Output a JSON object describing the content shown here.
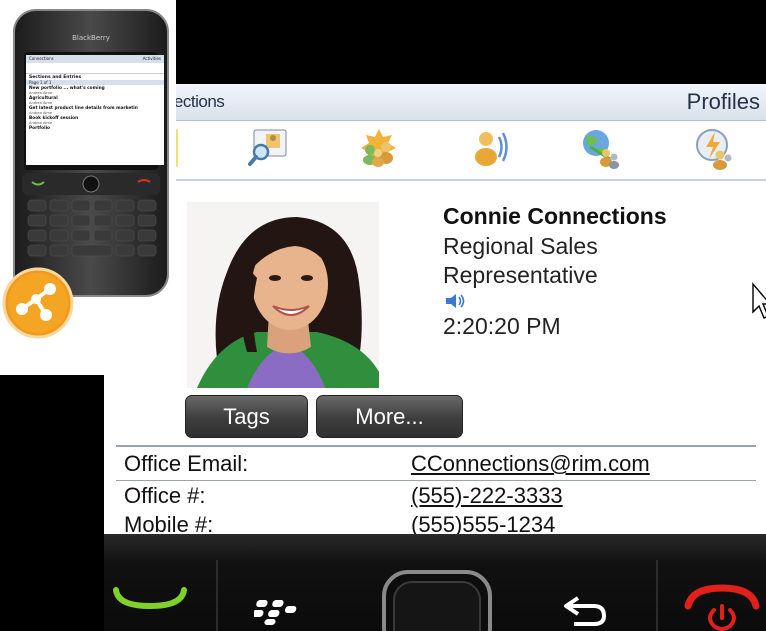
{
  "app": {
    "title": "Connections",
    "visible_title": "nnections",
    "screen_title": "Profiles"
  },
  "toolbar": {
    "icons": [
      "profile-search-icon",
      "community-icon",
      "colleagues-icon",
      "broadcast-icon",
      "network-icon",
      "status-icon"
    ]
  },
  "profile": {
    "name": "Connie Connections",
    "title_line1": "Regional Sales",
    "title_line2": "Representative",
    "local_time": "2:20:20 PM",
    "pronunciation_icon": "speaker-icon"
  },
  "actions": {
    "tags_label": "Tags",
    "more_label": "More..."
  },
  "details": [
    {
      "label": "Office Email:",
      "value": "CConnections@rim.com"
    },
    {
      "label": "Office #:",
      "value": "(555)-222-3333"
    },
    {
      "label": "Mobile #:",
      "value": "(555)555-1234"
    }
  ],
  "phone_preview": {
    "brand": "BlackBerry",
    "header_left": "Connections",
    "header_right": "Activities",
    "section_title": "Sections and Entries",
    "page": "Page 1 of 1",
    "entries": [
      {
        "title": "New portfolio ... what's coming",
        "author": "Andrea Aime"
      },
      {
        "title": "Agricultural",
        "author": "Andrea Aime"
      },
      {
        "title": "Get latest product line details from marketin",
        "author": "Andrea Aime"
      },
      {
        "title": "Book kickoff session",
        "author": "Andrea Aime"
      },
      {
        "title": "Portfolio",
        "author": ""
      }
    ]
  },
  "colors": {
    "titlebar": "#dde4ee",
    "button": "#3d3d3d",
    "hardware": "#111111",
    "call_green": "#7fd02a",
    "end_red": "#e0201a",
    "logo_orange": "#f39a1e"
  }
}
